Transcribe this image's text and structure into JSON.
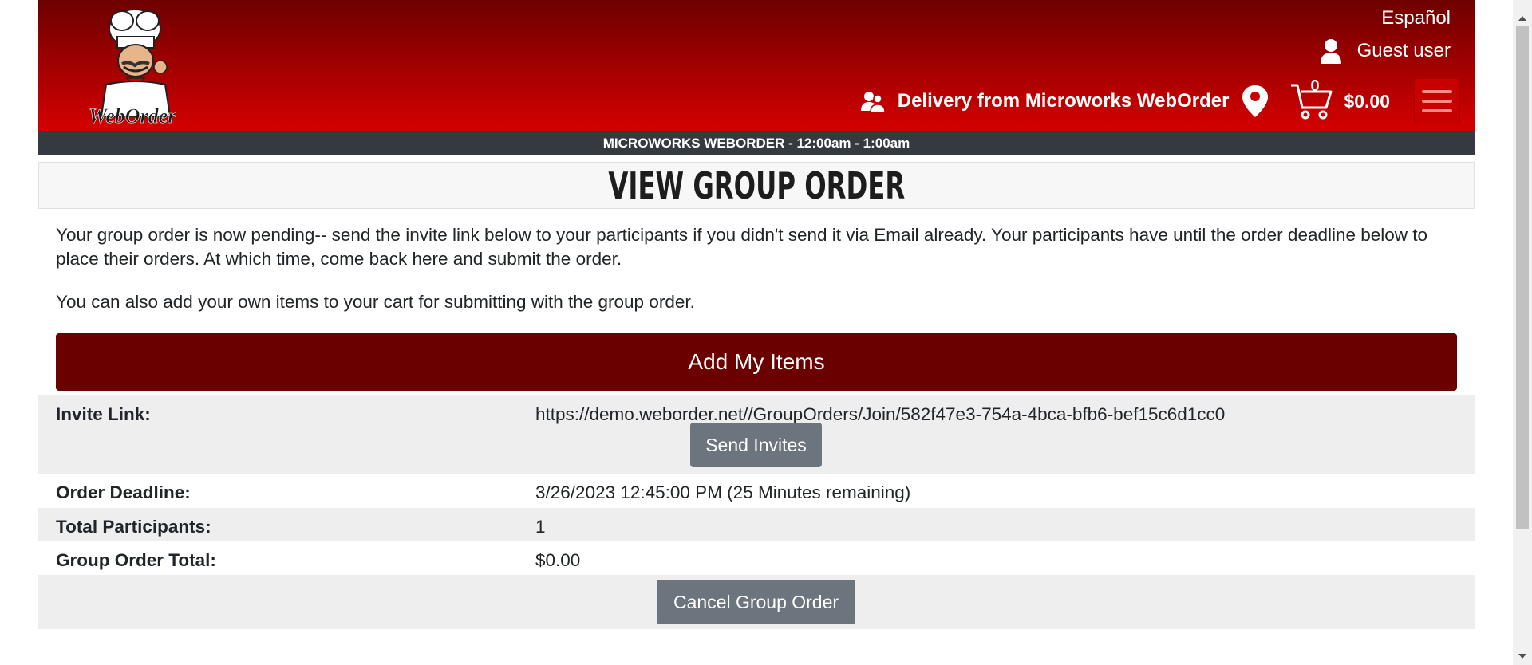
{
  "header": {
    "language_link": "Español",
    "user_label": "Guest user",
    "delivery_label": "Delivery from Microworks WebOrder",
    "cart_count": "0",
    "cart_total": "$0.00",
    "logo_text": "WebOrder"
  },
  "hours_bar": "MICROWORKS WEBORDER - 12:00am - 1:00am",
  "page_title": "VIEW GROUP ORDER",
  "intro": {
    "paragraph_1": "Your group order is now pending-- send the invite link below to your participants if you didn't send it via Email already. Your participants have until the order deadline below to place their orders. At which time, come back here and submit the order.",
    "paragraph_2": "You can also add your own items to your cart for submitting with the group order."
  },
  "add_items_button": "Add My Items",
  "details": {
    "invite_label": "Invite Link:",
    "invite_value": "https://demo.weborder.net//GroupOrders/Join/582f47e3-754a-4bca-bfb6-bef15c6d1cc0",
    "send_invites_button": "Send Invites",
    "deadline_label": "Order Deadline:",
    "deadline_value": "3/26/2023 12:45:00 PM (25 Minutes remaining)",
    "participants_label": "Total Participants:",
    "participants_value": "1",
    "total_label": "Group Order Total:",
    "total_value": "$0.00"
  },
  "cancel_button": "Cancel Group Order",
  "colors": {
    "header_dark": "#6e0000",
    "header_light": "#d40000",
    "primary_button": "#6b0000",
    "secondary_button": "#6c757d",
    "hours_bar": "#343a40"
  },
  "icons": [
    "chef-logo",
    "user-icon",
    "group-icon",
    "location-pin-icon",
    "cart-icon",
    "hamburger-menu-icon"
  ]
}
